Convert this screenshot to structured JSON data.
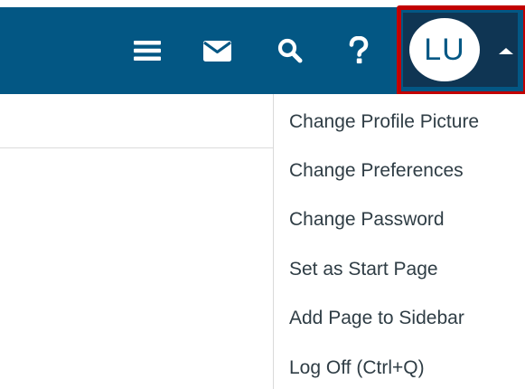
{
  "header": {
    "background_color": "#035784",
    "user_area_color": "#0f3553",
    "highlight_color": "#c20000",
    "icons": [
      {
        "name": "hamburger-menu-icon"
      },
      {
        "name": "envelope-icon"
      },
      {
        "name": "search-icon"
      },
      {
        "name": "help-question-icon"
      }
    ],
    "user": {
      "initials": "LU",
      "caret_icon": "caret-up-icon"
    }
  },
  "user_menu": {
    "items": [
      {
        "label": "Change Profile Picture"
      },
      {
        "label": "Change Preferences"
      },
      {
        "label": "Change Password"
      },
      {
        "label": "Set as Start Page"
      },
      {
        "label": "Add Page to Sidebar"
      },
      {
        "label": "Log Off (Ctrl+Q)"
      }
    ]
  }
}
